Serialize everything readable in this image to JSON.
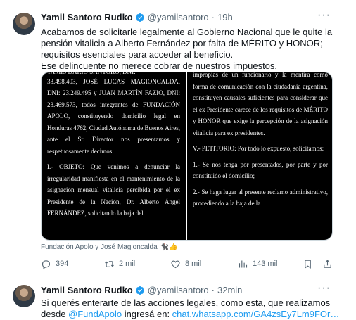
{
  "tweet1": {
    "name": "Yamil Santoro Rudko",
    "handle": "@yamilsantoro",
    "dot": "·",
    "time": "19h",
    "more": "···",
    "lines": [
      "Acabamos de solicitarle legalmente al Gobierno Nacional que le quite la",
      "pensión vitalicia a Alberto Fernández por falta de MÉRITO y HONOR;",
      "requisitos esenciales para acceder al beneficio.",
      "Ese delincuente no merece cobrar de nuestros impuestos."
    ],
    "document": {
      "left": {
        "top_cut": "TAMIS DARIO SANTORO, DNI:",
        "p1": "33.498.403, JOSÉ LUCAS MAGIONCALDA, DNI: 23.249.495 y JUAN MARTÍN FAZIO, DNI: 23.469.573, todos integrantes de FUNDACIÓN APOLO, constituyendo domicilio legal en Honduras 4762, Ciudad Autónoma de Buenos Aires, ante el Sr. Director nos presentamos y respetuosamente decimos:",
        "p2": "I.- OBJETO: Que venimos a denunciar la irregularidad manifiesta en el mantenimiento de la asignación mensual vitalicia percibida por el ex Presidente de la Nación, Dr. Alberto Ángel FERNÁNDEZ, solicitando la baja del"
      },
      "right": {
        "p1": "impropias de un funcionario y la mentira como forma de comunicación con la ciudadanía argentina, constituyen causales suficientes para considerar que el ex Presidente carece de los requisitos de MÉRITO y HONOR que exige la percepción de la asignación vitalicia para ex presidentes.",
        "p2": "V.- PETITORIO: Por todo lo expuesto, solicitamos:",
        "p3": "1.- Se nos tenga por presentados, por parte y por constituido el domicilio;",
        "p4": "2.- Se haga lugar al presente reclamo administrativo, procediendo a la baja de la"
      }
    },
    "caption": "Fundación Apolo y José Magioncalda",
    "caption_emoji": "🐈‍⬛👍",
    "stats": {
      "replies": "394",
      "reposts": "2 mil",
      "likes": "8 mil",
      "views": "143 mil"
    },
    "colors": {
      "verified": "#1d9bf0",
      "muted": "#536471"
    }
  },
  "tweet2": {
    "name": "Yamil Santoro Rudko",
    "handle": "@yamilsantoro",
    "dot": "·",
    "time": "32min",
    "more": "···",
    "line1": "Si querés enterarte de las acciones legales, como esta, que realizamos",
    "line2_pre": "desde ",
    "mention": "@FundApolo",
    "line2_mid": " ingresá en: ",
    "url": "chat.whatsapp.com/GA4zsEy7Lm9FOr…"
  }
}
